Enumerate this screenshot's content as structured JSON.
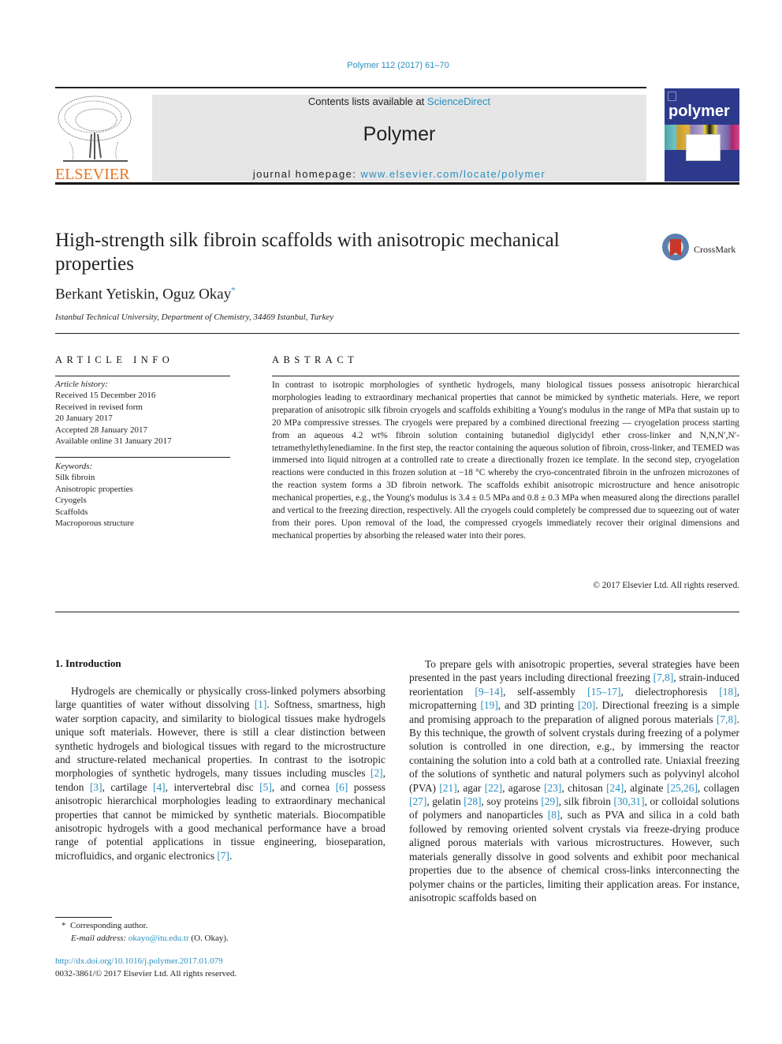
{
  "header": {
    "journal_ref": "Polymer 112 (2017) 61–70",
    "contents_prefix": "Contents lists available at ",
    "contents_link": "ScienceDirect",
    "journal_name": "Polymer",
    "homepage_prefix": "journal homepage: ",
    "homepage_link": "www.elsevier.com/locate/polymer",
    "publisher_logo_text": "ELSEVIER",
    "cover_title": "polymer",
    "colors": {
      "link": "#2a8fc0",
      "elsevier_orange": "#e8731e",
      "cover_blue": "#2d3a8c"
    }
  },
  "article": {
    "title": "High-strength silk fibroin scaffolds with anisotropic mechanical properties",
    "crossmark_label": "CrossMark",
    "authors": "Berkant Yetiskin, Oguz Okay",
    "author_marker": "*",
    "affiliation": "Istanbul Technical University, Department of Chemistry, 34469 Istanbul, Turkey"
  },
  "article_info": {
    "heading": "ARTICLE INFO",
    "history_label": "Article history:",
    "history": [
      "Received 15 December 2016",
      "Received in revised form",
      "20 January 2017",
      "Accepted 28 January 2017",
      "Available online 31 January 2017"
    ],
    "keywords_label": "Keywords:",
    "keywords": [
      "Silk fibroin",
      "Anisotropic properties",
      "Cryogels",
      "Scaffolds",
      "Macroporous structure"
    ]
  },
  "abstract": {
    "heading": "ABSTRACT",
    "body": "In contrast to isotropic morphologies of synthetic hydrogels, many biological tissues possess anisotropic hierarchical morphologies leading to extraordinary mechanical properties that cannot be mimicked by synthetic materials. Here, we report preparation of anisotropic silk fibroin cryogels and scaffolds exhibiting a Young's modulus in the range of MPa that sustain up to 20 MPa compressive stresses. The cryogels were prepared by a combined directional freezing — cryogelation process starting from an aqueous 4.2 wt% fibroin solution containing butanediol diglycidyl ether cross-linker and N,N,N′,N′-tetramethylethylenediamine. In the first step, the reactor containing the aqueous solution of fibroin, cross-linker, and TEMED was immersed into liquid nitrogen at a controlled rate to create a directionally frozen ice template. In the second step, cryogelation reactions were conducted in this frozen solution at −18 °C whereby the cryo-concentrated fibroin in the unfrozen microzones of the reaction system forms a 3D fibroin network. The scaffolds exhibit anisotropic microstructure and hence anisotropic mechanical properties, e.g., the Young's modulus is 3.4 ± 0.5 MPa and 0.8 ± 0.3 MPa when measured along the directions parallel and vertical to the freezing direction, respectively. All the cryogels could completely be compressed due to squeezing out of water from their pores. Upon removal of the load, the compressed cryogels immediately recover their original dimensions and mechanical properties by absorbing the released water into their pores.",
    "copyright": "© 2017 Elsevier Ltd. All rights reserved."
  },
  "introduction": {
    "heading": "1.  Introduction",
    "left_paragraph": [
      {
        "t": "Hydrogels are chemically or physically cross-linked polymers absorbing large quantities of water without dissolving "
      },
      {
        "ref": "[1]"
      },
      {
        "t": ". Softness, smartness, high water sorption capacity, and similarity to biological tissues make hydrogels unique soft materials. However, there is still a clear distinction between synthetic hydrogels and biological tissues with regard to the microstructure and structure-related mechanical properties. In contrast to the isotropic morphologies of synthetic hydrogels, many tissues including muscles "
      },
      {
        "ref": "[2]"
      },
      {
        "t": ", tendon "
      },
      {
        "ref": "[3]"
      },
      {
        "t": ", cartilage "
      },
      {
        "ref": "[4]"
      },
      {
        "t": ", intervertebral disc "
      },
      {
        "ref": "[5]"
      },
      {
        "t": ", and cornea "
      },
      {
        "ref": "[6]"
      },
      {
        "t": " possess anisotropic hierarchical morphologies leading to extraordinary mechanical properties that cannot be mimicked by synthetic materials. Biocompatible anisotropic hydrogels with a good mechanical performance have a broad range of potential applications in tissue engineering, bioseparation, microfluidics, and organic electronics "
      },
      {
        "ref": "[7]"
      },
      {
        "t": "."
      }
    ],
    "right_paragraph": [
      {
        "t": "To prepare gels with anisotropic properties, several strategies have been presented in the past years including directional freezing "
      },
      {
        "ref": "[7,8]"
      },
      {
        "t": ", strain-induced reorientation "
      },
      {
        "ref": "[9–14]"
      },
      {
        "t": ", self-assembly "
      },
      {
        "ref": "[15–17]"
      },
      {
        "t": ", dielectrophoresis "
      },
      {
        "ref": "[18]"
      },
      {
        "t": ", micropatterning "
      },
      {
        "ref": "[19]"
      },
      {
        "t": ", and 3D printing "
      },
      {
        "ref": "[20]"
      },
      {
        "t": ". Directional freezing is a simple and promising approach to the preparation of aligned porous materials "
      },
      {
        "ref": "[7,8]"
      },
      {
        "t": ". By this technique, the growth of solvent crystals during freezing of a polymer solution is controlled in one direction, e.g., by immersing the reactor containing the solution into a cold bath at a controlled rate. Uniaxial freezing of the solutions of synthetic and natural polymers such as polyvinyl alcohol (PVA) "
      },
      {
        "ref": "[21]"
      },
      {
        "t": ", agar "
      },
      {
        "ref": "[22]"
      },
      {
        "t": ", agarose "
      },
      {
        "ref": "[23]"
      },
      {
        "t": ", chitosan "
      },
      {
        "ref": "[24]"
      },
      {
        "t": ", alginate "
      },
      {
        "ref": "[25,26]"
      },
      {
        "t": ", collagen "
      },
      {
        "ref": "[27]"
      },
      {
        "t": ", gelatin "
      },
      {
        "ref": "[28]"
      },
      {
        "t": ", soy proteins "
      },
      {
        "ref": "[29]"
      },
      {
        "t": ", silk fibroin "
      },
      {
        "ref": "[30,31]"
      },
      {
        "t": ", or colloidal solutions of polymers and nanoparticles "
      },
      {
        "ref": "[8]"
      },
      {
        "t": ", such as PVA and silica in a cold bath followed by removing oriented solvent crystals via freeze-drying produce aligned porous materials with various microstructures. However, such materials generally dissolve in good solvents and exhibit poor mechanical properties due to the absence of chemical cross-links interconnecting the polymer chains or the particles, limiting their application areas. For instance, anisotropic scaffolds based on"
      }
    ]
  },
  "footnote": {
    "marker": "*",
    "corresponding": "Corresponding author.",
    "email_label": "E-mail address:",
    "email": "okayo@itu.edu.tr",
    "email_suffix": " (O. Okay)."
  },
  "doi": {
    "link": "http://dx.doi.org/10.1016/j.polymer.2017.01.079",
    "issn_line": "0032-3861/© 2017 Elsevier Ltd. All rights reserved."
  }
}
